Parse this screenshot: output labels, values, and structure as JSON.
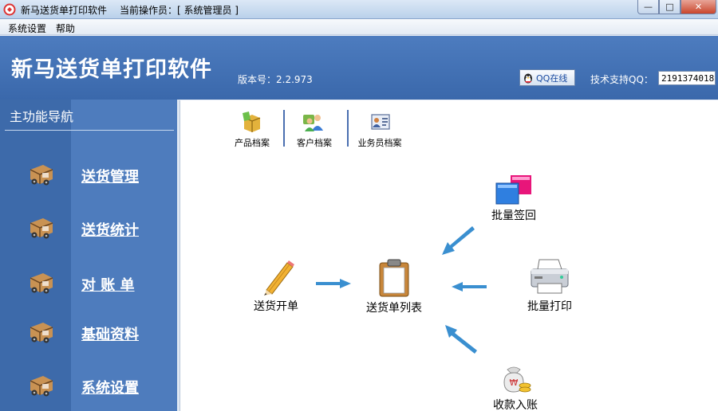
{
  "window": {
    "title": "新马送货单打印软件",
    "operator": "当前操作员：[ 系统管理员 ]",
    "minimize_glyph": "—",
    "maximize_glyph": "□",
    "close_glyph": "✕"
  },
  "menu": {
    "items": [
      {
        "label": "系统设置"
      },
      {
        "label": "帮助"
      }
    ]
  },
  "header": {
    "title": "新马送货单打印软件",
    "version": "版本号：2.2.973",
    "qq_button_label": "QQ在线",
    "support_label": "技术支持QQ：",
    "support_qq": "2191374018"
  },
  "nav": {
    "heading": "主功能导航",
    "items": [
      {
        "label": "送货管理",
        "icon": "delivery-truck-icon"
      },
      {
        "label": "送货统计",
        "icon": "delivery-truck-icon"
      },
      {
        "label": "对 账 单",
        "icon": "delivery-truck-icon"
      },
      {
        "label": "基础资料",
        "icon": "delivery-truck-icon"
      },
      {
        "label": "系统设置",
        "icon": "delivery-truck-icon"
      }
    ]
  },
  "toolbar": {
    "items": [
      {
        "label": "产品档案",
        "icon": "product-box-icon"
      },
      {
        "label": "客户档案",
        "icon": "customers-icon"
      },
      {
        "label": "业务员档案",
        "icon": "salesperson-card-icon"
      }
    ]
  },
  "flow": {
    "create_order": "送货开单",
    "order_list": "送货单列表",
    "batch_sign": "批量签回",
    "batch_print": "批量打印",
    "payment_entry": "收款入账"
  },
  "colors": {
    "banner": "#3a68ab",
    "nav_dark": "#3d6aaa",
    "nav_light": "#4e7cbd",
    "arrow": "#3a8fd0"
  }
}
